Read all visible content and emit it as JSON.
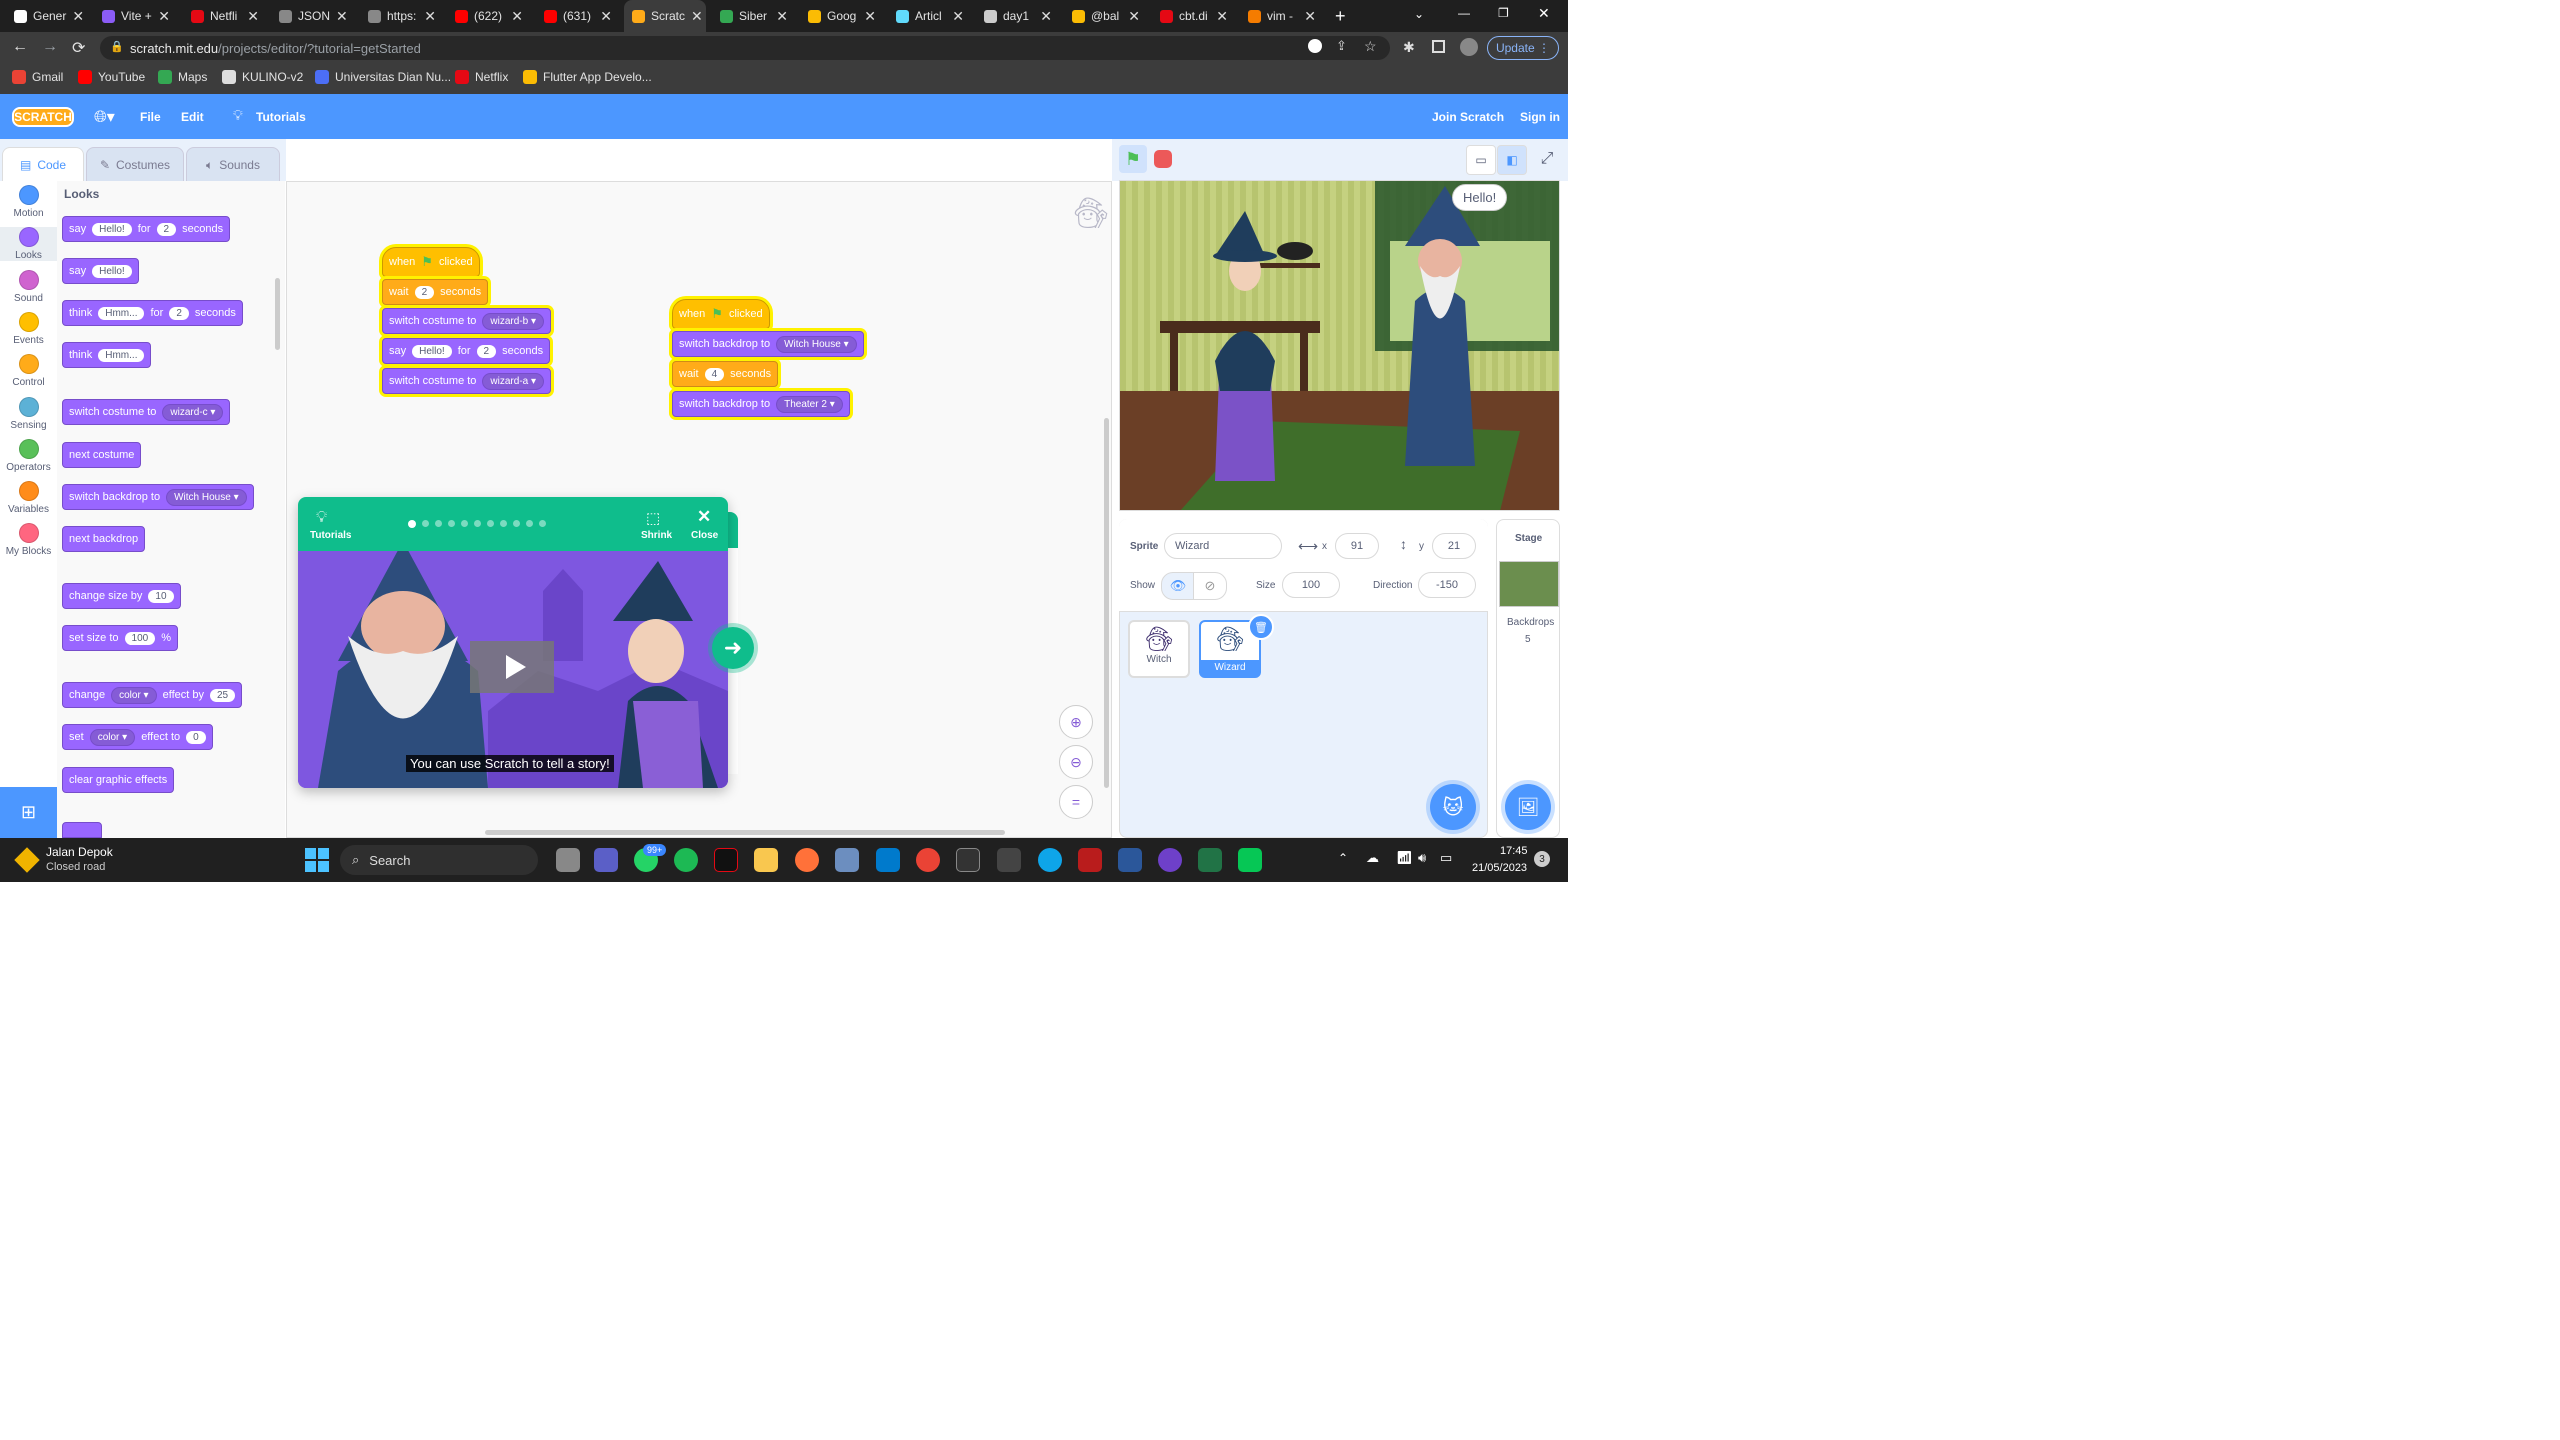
{
  "browser": {
    "tabs": [
      {
        "label": "Gener",
        "color": "#ffffff"
      },
      {
        "label": "Vite +",
        "color": "#8b5cf6"
      },
      {
        "label": "Netfli",
        "color": "#e50914"
      },
      {
        "label": "JSON",
        "color": "#888888"
      },
      {
        "label": "https:",
        "color": "#888888"
      },
      {
        "label": "(622)",
        "color": "#ff0000"
      },
      {
        "label": "(631)",
        "color": "#ff0000"
      },
      {
        "label": "Scratc",
        "color": "#ffab19"
      },
      {
        "label": "Siber",
        "color": "#34a853"
      },
      {
        "label": "Goog",
        "color": "#fbbc04"
      },
      {
        "label": "Articl",
        "color": "#61dafb"
      },
      {
        "label": "day1",
        "color": "#cccccc"
      },
      {
        "label": "@bal",
        "color": "#fbbc04"
      },
      {
        "label": "cbt.di",
        "color": "#e50914"
      },
      {
        "label": "vim -",
        "color": "#f57c00"
      }
    ],
    "url_host": "scratch.mit.edu",
    "url_path": "/projects/editor/?tutorial=getStarted",
    "update_label": "Update",
    "bookmarks": [
      "Gmail",
      "YouTube",
      "Maps",
      "KULINO-v2",
      "Universitas Dian Nu...",
      "Netflix",
      "Flutter App Develo..."
    ]
  },
  "menu": {
    "logo": "SCRATCH",
    "file": "File",
    "edit": "Edit",
    "tutorials": "Tutorials",
    "join": "Join Scratch",
    "signin": "Sign in"
  },
  "editor_tabs": {
    "code": "Code",
    "costumes": "Costumes",
    "sounds": "Sounds"
  },
  "categories": [
    {
      "label": "Motion",
      "color": "#4c97ff"
    },
    {
      "label": "Looks",
      "color": "#9966ff"
    },
    {
      "label": "Sound",
      "color": "#cf63cf"
    },
    {
      "label": "Events",
      "color": "#ffbf00"
    },
    {
      "label": "Control",
      "color": "#ffab19"
    },
    {
      "label": "Sensing",
      "color": "#5cb1d6"
    },
    {
      "label": "Operators",
      "color": "#59c059"
    },
    {
      "label": "Variables",
      "color": "#ff8c1a"
    },
    {
      "label": "My Blocks",
      "color": "#ff6680"
    }
  ],
  "palette": {
    "heading": "Looks",
    "say_for": {
      "a": "say",
      "v1": "Hello!",
      "b": "for",
      "v2": "2",
      "c": "seconds"
    },
    "say": {
      "a": "say",
      "v1": "Hello!"
    },
    "think_for": {
      "a": "think",
      "v1": "Hmm...",
      "b": "for",
      "v2": "2",
      "c": "seconds"
    },
    "think": {
      "a": "think",
      "v1": "Hmm..."
    },
    "switch_costume": {
      "a": "switch costume to",
      "v1": "wizard-c"
    },
    "next_costume": "next costume",
    "switch_backdrop": {
      "a": "switch backdrop to",
      "v1": "Witch House"
    },
    "next_backdrop": "next backdrop",
    "change_size": {
      "a": "change size by",
      "v1": "10"
    },
    "set_size": {
      "a": "set size to",
      "v1": "100",
      "b": "%"
    },
    "change_effect": {
      "a": "change",
      "v1": "color",
      "b": "effect by",
      "v2": "25"
    },
    "set_effect": {
      "a": "set",
      "v1": "color",
      "b": "effect to",
      "v2": "0"
    },
    "clear_effects": "clear graphic effects"
  },
  "script1": {
    "when": "when",
    "clicked": "clicked",
    "wait": "wait",
    "wait_v": "2",
    "seconds": "seconds",
    "switch1": "switch costume to",
    "switch1_v": "wizard-b",
    "say": "say",
    "say_v": "Hello!",
    "for": "for",
    "say_t": "2",
    "say_s": "seconds",
    "switch2": "switch costume to",
    "switch2_v": "wizard-a"
  },
  "script2": {
    "when": "when",
    "clicked": "clicked",
    "backdrop1": "switch backdrop to",
    "backdrop1_v": "Witch House",
    "wait": "wait",
    "wait_v": "4",
    "seconds": "seconds",
    "backdrop2": "switch backdrop to",
    "backdrop2_v": "Theater 2"
  },
  "tutorial": {
    "label": "Tutorials",
    "shrink": "Shrink",
    "close": "Close",
    "caption": "You can use Scratch to tell a story!"
  },
  "stage": {
    "speech": "Hello!"
  },
  "sprite_info": {
    "sprite_label": "Sprite",
    "sprite_name": "Wizard",
    "x_label": "x",
    "x": "91",
    "y_label": "y",
    "y": "21",
    "show_label": "Show",
    "size_label": "Size",
    "size": "100",
    "direction_label": "Direction",
    "direction": "-150"
  },
  "sprites": [
    {
      "name": "Witch"
    },
    {
      "name": "Wizard"
    }
  ],
  "stage_pane": {
    "title": "Stage",
    "backdrops_label": "Backdrops",
    "backdrops_count": "5"
  },
  "taskbar": {
    "weather_title": "Jalan Depok",
    "weather_sub": "Closed road",
    "search": "Search",
    "badge": "99+",
    "time": "17:45",
    "date": "21/05/2023",
    "notif": "3"
  }
}
